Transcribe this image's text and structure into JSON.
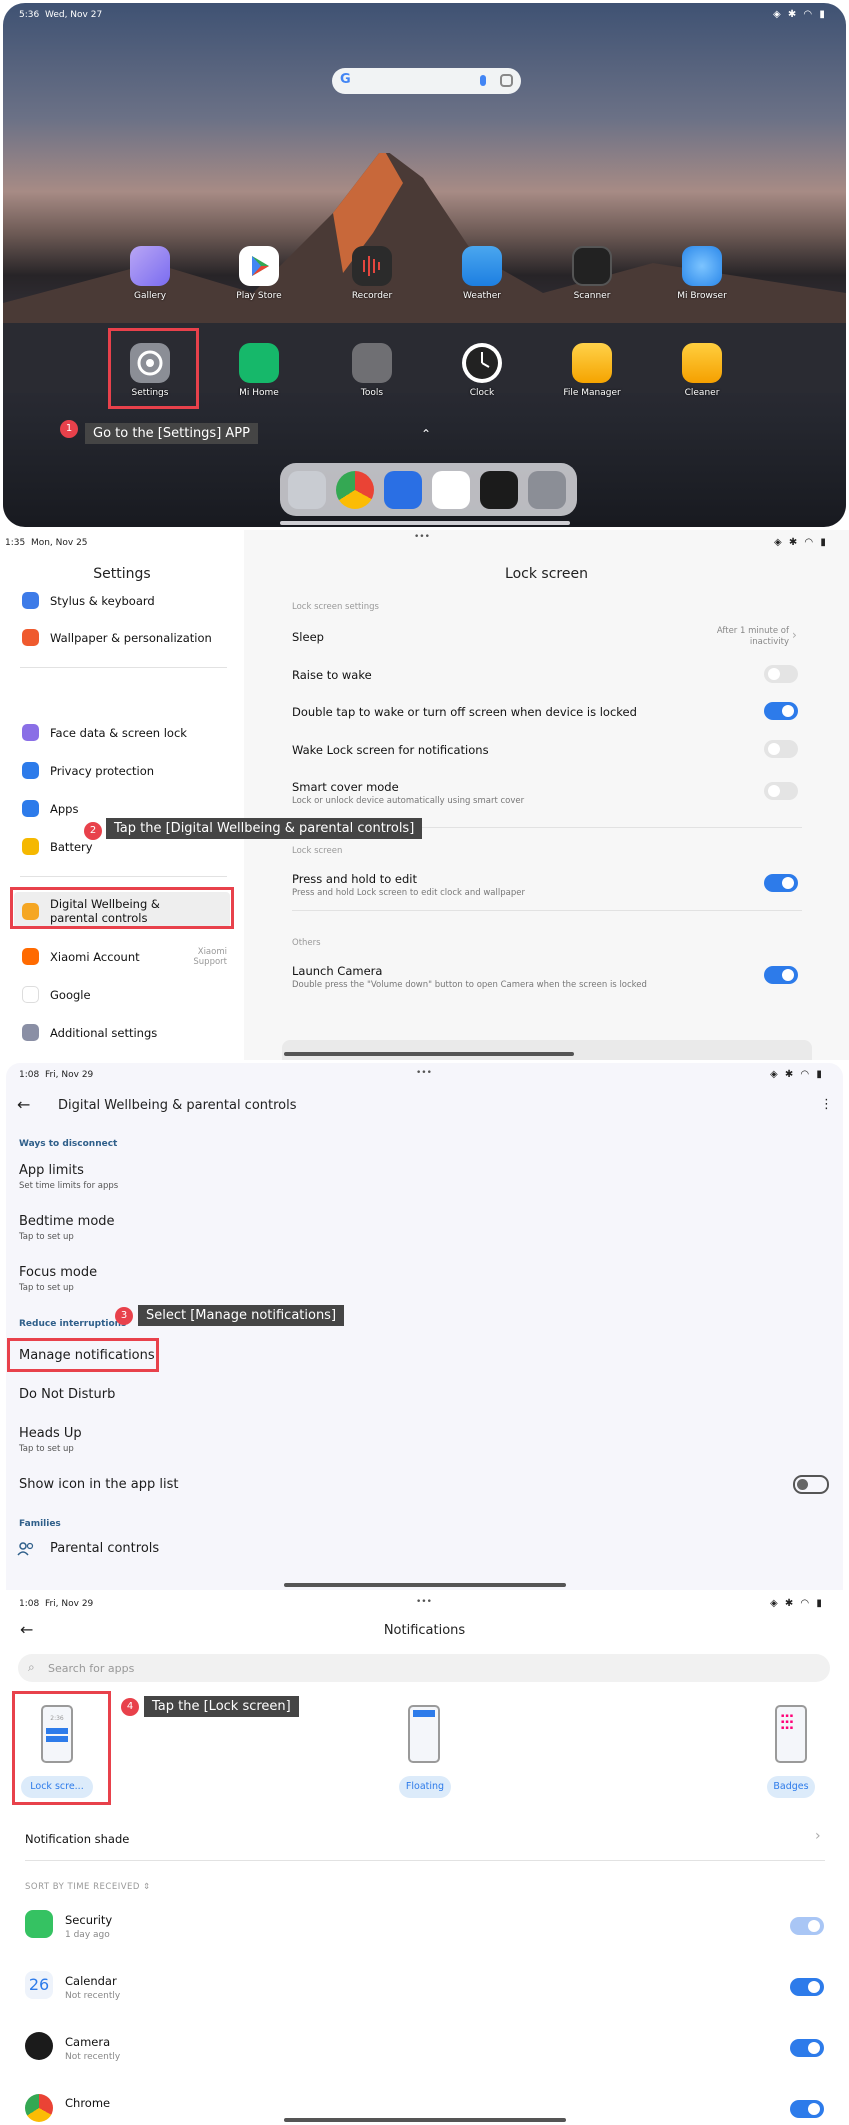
{
  "p1": {
    "time": "5:36",
    "date": "Wed, Nov 27",
    "apps_row1": [
      "Gallery",
      "Play Store",
      "Recorder",
      "Weather",
      "Scanner",
      "Mi Browser"
    ],
    "apps_row2": [
      "Settings",
      "Mi Home",
      "Tools",
      "Clock",
      "File Manager",
      "Cleaner"
    ],
    "step_num": "1",
    "tip": "Go to the [Settings] APP",
    "up_arrow": "⌃"
  },
  "p2": {
    "time": "1:35",
    "date": "Mon, Nov 25",
    "dots": "•••",
    "sidebar_title": "Settings",
    "sidebar": [
      {
        "label": "Stylus & keyboard",
        "color": "#3d7be8"
      },
      {
        "label": "Wallpaper & personalization",
        "color": "#ef5a2e"
      },
      {
        "label": "Face data & screen lock",
        "color": "#8a6fe6"
      },
      {
        "label": "Privacy protection",
        "color": "#2d7bea"
      },
      {
        "label": "Apps",
        "color": "#2d7bea"
      },
      {
        "label": "Battery",
        "color": "#f5b800"
      },
      {
        "label": "Digital Wellbeing & parental controls",
        "color": "#f5a623"
      },
      {
        "label": "Xiaomi Account",
        "color": "#ff6a00"
      },
      {
        "label": "Google",
        "color": "#ffffff"
      },
      {
        "label": "Additional settings",
        "color": "#8a8fa5"
      }
    ],
    "xiaomi_support": "Xiaomi\nSupport",
    "page_title": "Lock screen",
    "section1": "Lock screen settings",
    "sleep": "Sleep",
    "sleep_value": "After 1 minute of inactivity",
    "raise": "Raise to wake",
    "double_tap": "Double tap to wake or turn off screen when device is locked",
    "wake_notif": "Wake Lock screen for notifications",
    "smart_cover": "Smart cover mode",
    "smart_cover_sub": "Lock or unlock device automatically using smart cover",
    "section2": "Lock screen",
    "press_hold": "Press and hold to edit",
    "press_hold_sub": "Press and hold Lock screen to edit clock and wallpaper",
    "section3": "Others",
    "launch_cam": "Launch Camera",
    "launch_cam_sub": "Double press the \"Volume down\" button to open Camera when the screen is locked",
    "step_num": "2",
    "tip": "Tap the [Digital Wellbeing & parental controls]"
  },
  "p3": {
    "time": "1:08",
    "date": "Fri, Nov 29",
    "dots": "•••",
    "title": "Digital Wellbeing & parental controls",
    "sec_disconnect": "Ways to disconnect",
    "app_limits": "App limits",
    "app_limits_sub": "Set time limits for apps",
    "bedtime": "Bedtime mode",
    "bedtime_sub": "Tap to set up",
    "focus": "Focus mode",
    "focus_sub": "Tap to set up",
    "sec_reduce": "Reduce interruptions",
    "manage": "Manage notifications",
    "dnd": "Do Not Disturb",
    "headsup": "Heads Up",
    "headsup_sub": "Tap to set up",
    "show_icon": "Show icon in the app list",
    "sec_families": "Families",
    "parental": "Parental controls",
    "step_num": "3",
    "tip": "Select [Manage notifications]"
  },
  "p4": {
    "time": "1:08",
    "date": "Fri, Nov 29",
    "dots": "•••",
    "title": "Notifications",
    "search_placeholder": "Search for apps",
    "phone_time": "2:36",
    "lock_label": "Lock scre...",
    "floating_label": "Floating",
    "badges_label": "Badges",
    "shade": "Notification shade",
    "sort": "SORT BY TIME RECEIVED",
    "apps": [
      {
        "name": "Security",
        "sub": "1 day ago"
      },
      {
        "name": "Calendar",
        "sub": "Not recently",
        "icon_text": "26"
      },
      {
        "name": "Camera",
        "sub": "Not recently"
      },
      {
        "name": "Chrome",
        "sub": ""
      }
    ],
    "step_num": "4",
    "tip": "Tap the [Lock screen]"
  }
}
